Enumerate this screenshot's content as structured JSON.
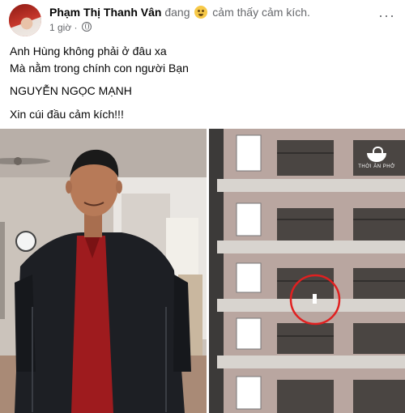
{
  "post": {
    "author": "Phạm Thị Thanh Vân",
    "feeling_prefix": "đang",
    "feeling_text": "cảm thấy cảm kích.",
    "emoji_icon": "slightly-smiling-face-emoji",
    "timestamp": "1 giờ ·",
    "privacy_icon": "globe-icon",
    "more_label": "···",
    "lines": [
      "Anh Hùng không phải ở đâu xa",
      "Mà nằm trong chính con người Bạn",
      "NGUYỄN NGỌC MẠNH",
      "Xin cúi đầu cảm kích!!!"
    ]
  },
  "photos": {
    "watermark_text": "THỜI ĂN PHỞ",
    "highlight_color": "#e02020"
  }
}
